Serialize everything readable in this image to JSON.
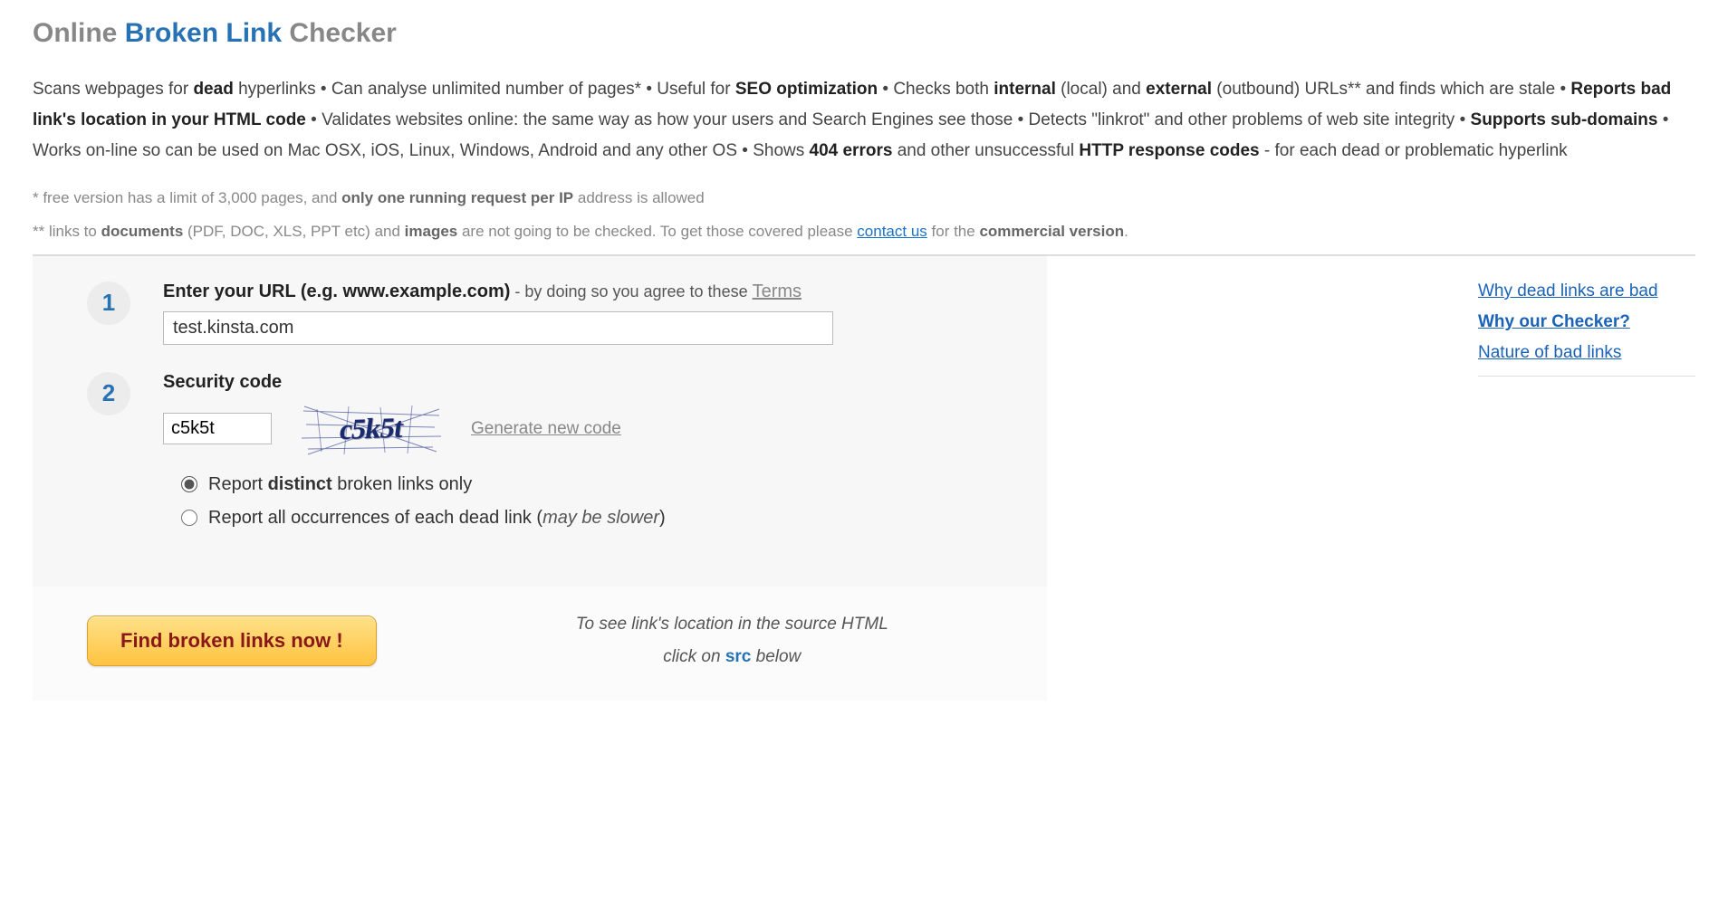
{
  "title": {
    "part1": "Online ",
    "part2": "Broken Link",
    "part3": " Checker"
  },
  "description": {
    "t1": "Scans webpages for ",
    "b1": "dead",
    "t2": " hyperlinks • Can analyse unlimited number of pages* • Useful for ",
    "b2": "SEO optimization",
    "t3": " • Checks both ",
    "b3": "internal",
    "t4": " (local) and ",
    "b4": "external",
    "t5": " (outbound) URLs** and finds which are stale • ",
    "b5": "Reports bad link's location in your HTML code",
    "t6": " • Validates websites online: the same way as how your users and Search Engines see those • Detects \"linkrot\" and other problems of web site integrity • ",
    "b6": "Supports sub-domains",
    "t7": " • Works on-line so can be used on Mac OSX, iOS, Linux, Windows, Android and any other OS • Shows ",
    "b7": "404 errors",
    "t8": " and other unsuccessful ",
    "b8": "HTTP response codes",
    "t9": " - for each dead or problematic hyperlink"
  },
  "footnote1": {
    "t1": "*  free version has a limit of 3,000 pages, and ",
    "b1": "only one running request per IP",
    "t2": " address is allowed"
  },
  "footnote2": {
    "t1": "** links to ",
    "b1": "documents",
    "t2": " (PDF, DOC, XLS, PPT etc) and ",
    "b2": "images",
    "t3": " are not going to be checked. To get those covered please ",
    "link": "contact us",
    "t4": " for the ",
    "b3": "commercial version",
    "t5": "."
  },
  "form": {
    "step1_num": "1",
    "step1_label_bold": "Enter your URL (e.g. www.example.com)",
    "step1_label_light": " - by doing so you agree to these ",
    "step1_terms": "Terms",
    "url_value": "test.kinsta.com",
    "step2_num": "2",
    "step2_label": "Security code",
    "code_value": "c5k5t",
    "captcha_text": "c5k5t",
    "generate_link": "Generate new code",
    "radio1_t1": "Report ",
    "radio1_b": "distinct",
    "radio1_t2": " broken links only",
    "radio2_t1": "Report all occurrences of each dead link (",
    "radio2_em": "may be slower",
    "radio2_t2": ")"
  },
  "action": {
    "button": "Find broken links now !",
    "instr_line1": "To see link's location in the source HTML",
    "instr_t1": "click on ",
    "instr_src": "src",
    "instr_t2": " below"
  },
  "sidebar": {
    "link1": "Why dead links are bad",
    "link2": "Why our Checker?",
    "link3": "Nature of bad links"
  }
}
